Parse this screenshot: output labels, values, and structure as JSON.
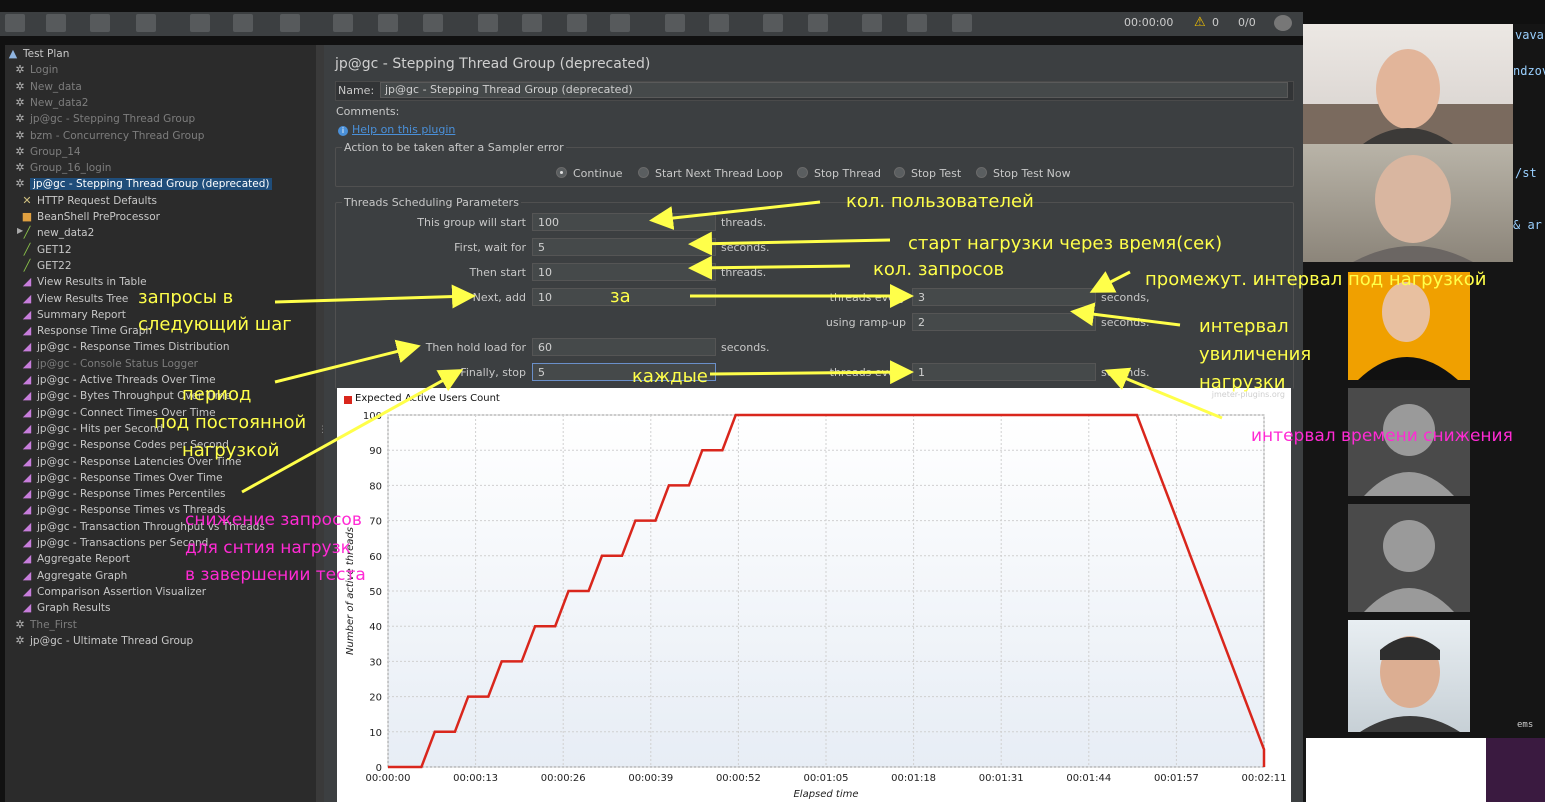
{
  "toolbar": {
    "timer": "00:00:00",
    "warnings": "0",
    "threads_ratio": "0/0"
  },
  "tree": [
    {
      "label": "Test Plan",
      "icon": "test-plan-icon",
      "level": 0,
      "disabled": false
    },
    {
      "label": "Login",
      "icon": "gear-icon",
      "level": 1,
      "disabled": true
    },
    {
      "label": "New_data",
      "icon": "gear-icon",
      "level": 1,
      "disabled": true
    },
    {
      "label": "New_data2",
      "icon": "gear-icon",
      "level": 1,
      "disabled": true
    },
    {
      "label": "jp@gc - Stepping Thread Group",
      "icon": "gear-icon",
      "level": 1,
      "disabled": true
    },
    {
      "label": "bzm - Concurrency Thread Group",
      "icon": "gear-icon",
      "level": 1,
      "disabled": true
    },
    {
      "label": "Group_14",
      "icon": "gear-icon",
      "level": 1,
      "disabled": true
    },
    {
      "label": "Group_16_login",
      "icon": "gear-icon",
      "level": 1,
      "disabled": true
    },
    {
      "label": "jp@gc - Stepping Thread Group (deprecated)",
      "icon": "gear-icon",
      "level": 1,
      "disabled": false,
      "selected": true
    },
    {
      "label": "HTTP Request Defaults",
      "icon": "wrench-icon",
      "level": 2,
      "disabled": false
    },
    {
      "label": "BeanShell PreProcessor",
      "icon": "bean-icon",
      "level": 2,
      "disabled": false
    },
    {
      "label": "new_data2",
      "icon": "pipette-icon",
      "level": 2,
      "disabled": false,
      "expandable": true
    },
    {
      "label": "GET12",
      "icon": "pipette-icon",
      "level": 2,
      "disabled": false
    },
    {
      "label": "GET22",
      "icon": "pipette-icon",
      "level": 2,
      "disabled": false
    },
    {
      "label": "View Results in Table",
      "icon": "chart-icon",
      "level": 2,
      "disabled": false
    },
    {
      "label": "View Results Tree",
      "icon": "chart-icon",
      "level": 2,
      "disabled": false
    },
    {
      "label": "Summary Report",
      "icon": "chart-icon",
      "level": 2,
      "disabled": false
    },
    {
      "label": "Response Time Graph",
      "icon": "chart-icon",
      "level": 2,
      "disabled": false
    },
    {
      "label": "jp@gc - Response Times Distribution",
      "icon": "chart-icon",
      "level": 2,
      "disabled": false
    },
    {
      "label": "jp@gc - Console Status Logger",
      "icon": "chart-icon",
      "level": 2,
      "disabled": true
    },
    {
      "label": "jp@gc - Active Threads Over Time",
      "icon": "chart-icon",
      "level": 2,
      "disabled": false
    },
    {
      "label": "jp@gc - Bytes Throughput Over Time",
      "icon": "chart-icon",
      "level": 2,
      "disabled": false
    },
    {
      "label": "jp@gc - Connect Times Over Time",
      "icon": "chart-icon",
      "level": 2,
      "disabled": false
    },
    {
      "label": "jp@gc - Hits per Second",
      "icon": "chart-icon",
      "level": 2,
      "disabled": false
    },
    {
      "label": "jp@gc - Response Codes per Second",
      "icon": "chart-icon",
      "level": 2,
      "disabled": false
    },
    {
      "label": "jp@gc - Response Latencies Over Time",
      "icon": "chart-icon",
      "level": 2,
      "disabled": false
    },
    {
      "label": "jp@gc - Response Times Over Time",
      "icon": "chart-icon",
      "level": 2,
      "disabled": false
    },
    {
      "label": "jp@gc - Response Times Percentiles",
      "icon": "chart-icon",
      "level": 2,
      "disabled": false
    },
    {
      "label": "jp@gc - Response Times vs Threads",
      "icon": "chart-icon",
      "level": 2,
      "disabled": false
    },
    {
      "label": "jp@gc - Transaction Throughput vs Threads",
      "icon": "chart-icon",
      "level": 2,
      "disabled": false
    },
    {
      "label": "jp@gc - Transactions per Second",
      "icon": "chart-icon",
      "level": 2,
      "disabled": false
    },
    {
      "label": "Aggregate Report",
      "icon": "chart-icon",
      "level": 2,
      "disabled": false
    },
    {
      "label": "Aggregate Graph",
      "icon": "chart-icon",
      "level": 2,
      "disabled": false
    },
    {
      "label": "Comparison Assertion Visualizer",
      "icon": "chart-icon",
      "level": 2,
      "disabled": false
    },
    {
      "label": "Graph Results",
      "icon": "chart-icon",
      "level": 2,
      "disabled": false
    },
    {
      "label": "The_First",
      "icon": "gear-icon",
      "level": 1,
      "disabled": true
    },
    {
      "label": "jp@gc - Ultimate Thread Group",
      "icon": "gear-icon",
      "level": 1,
      "disabled": false
    }
  ],
  "panel": {
    "title": "jp@gc - Stepping Thread Group (deprecated)",
    "name_label": "Name:",
    "name_value": "jp@gc - Stepping Thread Group (deprecated)",
    "comments_label": "Comments:",
    "help_link": "Help on this plugin",
    "sampler_error": {
      "legend": "Action to be taken after a Sampler error",
      "options": [
        "Continue",
        "Start Next Thread Loop",
        "Stop Thread",
        "Stop Test",
        "Stop Test Now"
      ],
      "selected": "Continue"
    },
    "scheduling": {
      "legend": "Threads Scheduling Parameters",
      "start_label": "This group will start",
      "start_value": "100",
      "start_suffix": "threads.",
      "wait_label": "First, wait for",
      "wait_value": "5",
      "wait_suffix": "seconds.",
      "then_start_label": "Then start",
      "then_start_value": "10",
      "then_start_suffix": "threads.",
      "next_add_label": "Next, add",
      "next_add_value": "10",
      "next_add_mid": "threads every",
      "next_add_every": "3",
      "next_add_suffix": "seconds,",
      "rampup_label": "using ramp-up",
      "rampup_value": "2",
      "rampup_suffix": "seconds.",
      "hold_label": "Then hold load for",
      "hold_value": "60",
      "hold_suffix": "seconds.",
      "stop_label": "Finally, stop",
      "stop_value": "5",
      "stop_mid": "threads every",
      "stop_every": "1",
      "stop_suffix": "seconds."
    }
  },
  "chart_data": {
    "type": "line",
    "title": "",
    "legend": [
      "Expected Active Users Count"
    ],
    "watermark": "jmeter-plugins.org",
    "xlabel": "Elapsed time",
    "ylabel": "Number of active threads",
    "ylim": [
      0,
      100
    ],
    "xlim_seconds": [
      0,
      131
    ],
    "x_ticks": [
      "00:00:00",
      "00:00:13",
      "00:00:26",
      "00:00:39",
      "00:00:52",
      "00:01:05",
      "00:01:18",
      "00:01:31",
      "00:01:44",
      "00:01:57",
      "00:02:11"
    ],
    "y_ticks": [
      0,
      10,
      20,
      30,
      40,
      50,
      60,
      70,
      80,
      90,
      100
    ],
    "color": "#d9261c",
    "series": [
      {
        "name": "Expected Active Users Count",
        "x_seconds": [
          0,
          5,
          7,
          10,
          12,
          15,
          17,
          20,
          22,
          25,
          27,
          30,
          32,
          35,
          37,
          40,
          42,
          45,
          47,
          50,
          52,
          112,
          113,
          114,
          115,
          116,
          117,
          118,
          119,
          120,
          121,
          122,
          123,
          124,
          125,
          126,
          127,
          128,
          129,
          130,
          131,
          132
        ],
        "y": [
          0,
          0,
          10,
          10,
          20,
          20,
          30,
          30,
          40,
          40,
          50,
          50,
          60,
          60,
          70,
          70,
          80,
          80,
          90,
          90,
          100,
          100,
          95,
          90,
          85,
          80,
          75,
          70,
          65,
          60,
          55,
          50,
          45,
          40,
          35,
          30,
          25,
          20,
          15,
          10,
          5,
          0
        ]
      }
    ]
  },
  "annotations": {
    "users": "кол. пользователей",
    "start_delay": "старт нагрузки через время(сек)",
    "requests_count": "кол. запросов",
    "step_interval": "промежут. интервал под нагрузкой",
    "requests_step_1": "запросы в",
    "requests_step_2": "следующий шаг",
    "za": "за",
    "ramp_1": "интервал",
    "ramp_2": "увиличения",
    "ramp_3": "нагрузки",
    "hold_1": "период",
    "hold_2": "под постоянной",
    "hold_3": "нагрузкой",
    "each": "каждые",
    "decrease_interval": "интервал времени снижения",
    "stop_1": "снижение запросов",
    "stop_2": "для снтия нагрузк",
    "stop_3": "в завершении теста"
  },
  "sidebar_code": [
    "vava",
    "ndzov",
    "/st",
    "& ar",
    "ems"
  ]
}
